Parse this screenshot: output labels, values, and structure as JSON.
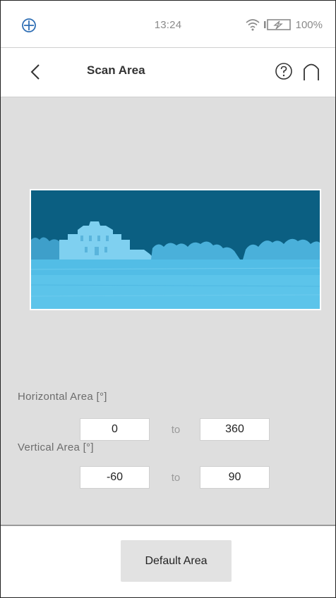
{
  "status": {
    "time": "13:24",
    "battery": "100%"
  },
  "header": {
    "title": "Scan Area"
  },
  "horizontal": {
    "label": "Horizontal Area [°]",
    "from": "0",
    "to_label": "to",
    "to": "360"
  },
  "vertical": {
    "label": "Vertical Area [°]",
    "from": "-60",
    "to_label": "to",
    "to": "90"
  },
  "footer": {
    "default_label": "Default Area"
  },
  "colors": {
    "preview_sky": "#0b5f82",
    "preview_ground": "#52bde6",
    "content_bg": "#dedede"
  }
}
